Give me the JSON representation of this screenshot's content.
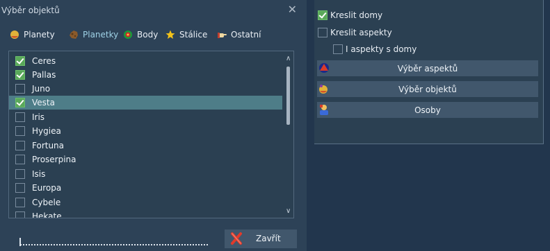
{
  "dialog": {
    "title": "Výběr objektů",
    "close_glyph": "✕",
    "tabs": [
      {
        "label": "Planety",
        "icon": "planet-icon"
      },
      {
        "label": "Planetky",
        "icon": "asteroid-icon",
        "active": true
      },
      {
        "label": "Body",
        "icon": "point-icon"
      },
      {
        "label": "Stálice",
        "icon": "star-icon"
      },
      {
        "label": "Ostatní",
        "icon": "hand-icon"
      }
    ],
    "items": [
      {
        "label": "Ceres",
        "checked": true
      },
      {
        "label": "Pallas",
        "checked": true
      },
      {
        "label": "Juno",
        "checked": false
      },
      {
        "label": "Vesta",
        "checked": true,
        "selected": true
      },
      {
        "label": "Iris",
        "checked": false
      },
      {
        "label": "Hygiea",
        "checked": false
      },
      {
        "label": "Fortuna",
        "checked": false
      },
      {
        "label": "Proserpina",
        "checked": false
      },
      {
        "label": "Isis",
        "checked": false
      },
      {
        "label": "Europa",
        "checked": false
      },
      {
        "label": "Cybele",
        "checked": false
      },
      {
        "label": "Hekate",
        "checked": false
      }
    ],
    "close_button": "Zavřít"
  },
  "panel": {
    "options": [
      {
        "label": "Kreslit domy",
        "checked": true
      },
      {
        "label": "Kreslit aspekty",
        "checked": false
      },
      {
        "label": "I aspekty s domy",
        "checked": false
      }
    ],
    "buttons": [
      {
        "label": "Výběr aspektů",
        "icon": "aspect-icon"
      },
      {
        "label": "Výběr objektů",
        "icon": "objects-icon"
      },
      {
        "label": "Osoby",
        "icon": "person-icon"
      }
    ]
  }
}
